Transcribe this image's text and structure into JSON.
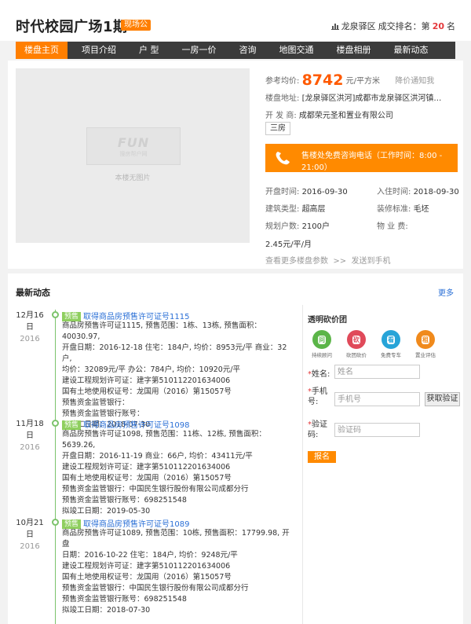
{
  "header": {
    "title": "时代校园广场1期",
    "status_badge": "现场公",
    "district": "龙泉驿区",
    "rank_label": "成交排名：第",
    "rank_value": "20",
    "rank_suffix": "名"
  },
  "nav": {
    "items": [
      {
        "label": "楼盘主页",
        "active": true
      },
      {
        "label": "项目介绍"
      },
      {
        "label": "户 型"
      },
      {
        "label": "一房一价"
      },
      {
        "label": "咨询"
      },
      {
        "label": "地图交通"
      },
      {
        "label": "楼盘相册"
      },
      {
        "label": "最新动态"
      }
    ]
  },
  "gallery": {
    "brand": "FUN",
    "brand_sub": "搜房帮户网",
    "no_photo": "本楼无图片"
  },
  "details": {
    "price_label": "参考均价:",
    "price_value": "8742",
    "price_unit": "元/平方米",
    "price_notify": "降价通知我",
    "address_label": "楼盘地址:",
    "address_value": "[龙泉驿区洪河]成都市龙泉驿区洪河镇…",
    "developer_label": "开 发 商:",
    "developer_value": "成都荣元圣和置业有限公司",
    "tag": "三房",
    "hotline_line1": "售楼处免费咨询电话（工作时间：8:00 -",
    "hotline_line2": "21:00）",
    "open_label": "开盘时间:",
    "open_value": "2016-09-30",
    "checkin_label": "入住时间:",
    "checkin_value": "2018-09-30",
    "type_label": "建筑类型:",
    "type_value": "超高层",
    "decor_label": "装修标准:",
    "decor_value": "毛坯",
    "households_label": "规划户数:",
    "households_value": "2100户",
    "mgmt_label": "物 业 费:",
    "mgmt_value": "2.45元/平/月",
    "more_params": "查看更多楼盘参数",
    "send_phone": "发送到手机"
  },
  "news": {
    "title": "最新动态",
    "more": "更多",
    "entries": [
      {
        "month_day": "12月16",
        "day_char": "日",
        "year": "2016",
        "category": "预售",
        "title": "取得商品房预售许可证号1115",
        "lines": [
          "商品房预售许可证1115, 预售范围：1栋、13栋, 预售面积：40030.97,",
          "开盘日期：2016-12-18 住宅：184户, 均价：8953元/平 商业：32户,",
          "均价：32089元/平 办公：784户, 均价：10920元/平",
          "建设工程规划许可证：建字第510112201634006",
          "国有土地使用权证号：龙国用（2016）第15057号",
          "预售资金监管银行：",
          "预售资金监管银行账号：",
          "拟竣工日期：2018-07-30"
        ]
      },
      {
        "month_day": "11月18",
        "day_char": "日",
        "year": "2016",
        "category": "预售",
        "title": "取得商品房预售许可证号1098",
        "lines": [
          "商品房预售许可证1098, 预售范围：11栋、12栋, 预售面积：5639.26,",
          "开盘日期：2016-11-19 商业：66户, 均价：43411元/平",
          "建设工程规划许可证：建字第510112201634006",
          "国有土地使用权证号：龙国用（2016）第15057号",
          "预售资金监管银行：中国民生银行股份有限公司成都分行",
          "预售资金监管银行账号：698251548",
          "拟竣工日期：2019-05-30"
        ]
      },
      {
        "month_day": "10月21",
        "day_char": "日",
        "year": "2016",
        "category": "预售",
        "title": "取得商品房预售许可证号1089",
        "lines": [
          "商品房预售许可证1089, 预售范围：10栋, 预售面积：17799.98, 开盘",
          "日期：2016-10-22 住宅：184户, 均价：9248元/平",
          "建设工程规划许可证：建字第510112201634006",
          "国有土地使用权证号：龙国用（2016）第15057号",
          "预售资金监管银行：中国民生银行股份有限公司成都分行",
          "预售资金监管银行账号：698251548",
          "拟竣工日期：2018-07-30"
        ]
      }
    ]
  },
  "form": {
    "title": "透明砍价团",
    "badges": [
      {
        "glyph": "问",
        "label": "持续顾问",
        "color": "#5bb548"
      },
      {
        "glyph": "砍",
        "label": "砍团砍价",
        "color": "#e04a5a"
      },
      {
        "glyph": "看",
        "label": "免费专车",
        "color": "#27a4d8"
      },
      {
        "glyph": "租",
        "label": "置业评估",
        "color": "#f08a1c"
      }
    ],
    "name_label": "姓名:",
    "name_placeholder": "姓名",
    "phone_label_a": "手机",
    "phone_label_b": "号:",
    "phone_placeholder": "手机号",
    "get_code": "获取验证",
    "code_label_a": "验证",
    "code_label_b": "码:",
    "code_placeholder": "验证码",
    "submit": "报名",
    "req_mark": "*"
  },
  "colors": {
    "accent": "#ff7f00",
    "price": "#ff5a00",
    "link": "#2a6fd6",
    "timeline": "#7cc36b",
    "nav_bg": "#3b3b3b"
  }
}
